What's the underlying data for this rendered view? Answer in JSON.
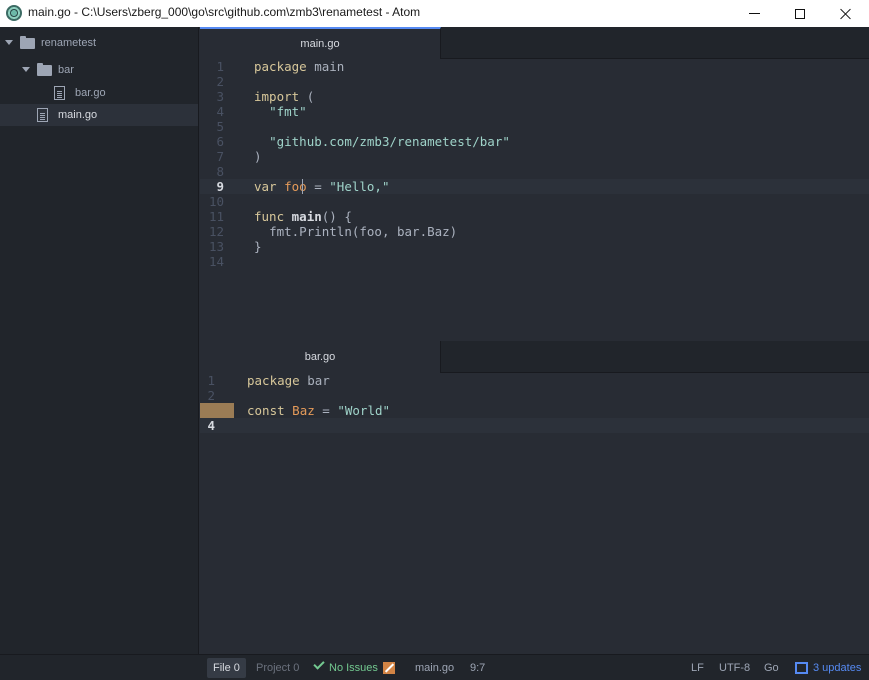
{
  "window": {
    "title": "main.go - C:\\Users\\zberg_000\\go\\src\\github.com\\zmb3\\renametest - Atom"
  },
  "tree": {
    "root": "renametest",
    "items": [
      {
        "label": "bar"
      },
      {
        "label": "bar.go"
      },
      {
        "label": "main.go"
      }
    ]
  },
  "top_pane": {
    "tab": "main.go",
    "cursor_line": 9,
    "lines": [
      {
        "n": "1",
        "text": "package main"
      },
      {
        "n": "2",
        "text": ""
      },
      {
        "n": "3",
        "text": "import ("
      },
      {
        "n": "4",
        "text": "  \"fmt\""
      },
      {
        "n": "5",
        "text": ""
      },
      {
        "n": "6",
        "text": "  \"github.com/zmb3/renametest/bar\""
      },
      {
        "n": "7",
        "text": ")"
      },
      {
        "n": "8",
        "text": ""
      },
      {
        "n": "9",
        "text": "var foo = \"Hello,\""
      },
      {
        "n": "10",
        "text": ""
      },
      {
        "n": "11",
        "text": "func main() {"
      },
      {
        "n": "12",
        "text": "  fmt.Println(foo, bar.Baz)"
      },
      {
        "n": "13",
        "text": "}"
      },
      {
        "n": "14",
        "text": ""
      }
    ]
  },
  "bottom_pane": {
    "tab": "bar.go",
    "cursor_line": 4,
    "modified_line": 3,
    "lines": [
      {
        "n": "1",
        "text": "package bar"
      },
      {
        "n": "2",
        "text": ""
      },
      {
        "n": "3",
        "text": "const Baz = \"World\""
      },
      {
        "n": "4",
        "text": ""
      }
    ]
  },
  "status": {
    "file_label": "File 0",
    "project_label": "Project 0",
    "no_issues": "No Issues",
    "filename": "main.go",
    "cursor_pos": "9:7",
    "line_ending": "LF",
    "encoding": "UTF-8",
    "grammar": "Go",
    "updates": "3 updates"
  },
  "colors": {
    "accent": "#568af2",
    "success": "#73c990",
    "warning": "#d28445"
  }
}
